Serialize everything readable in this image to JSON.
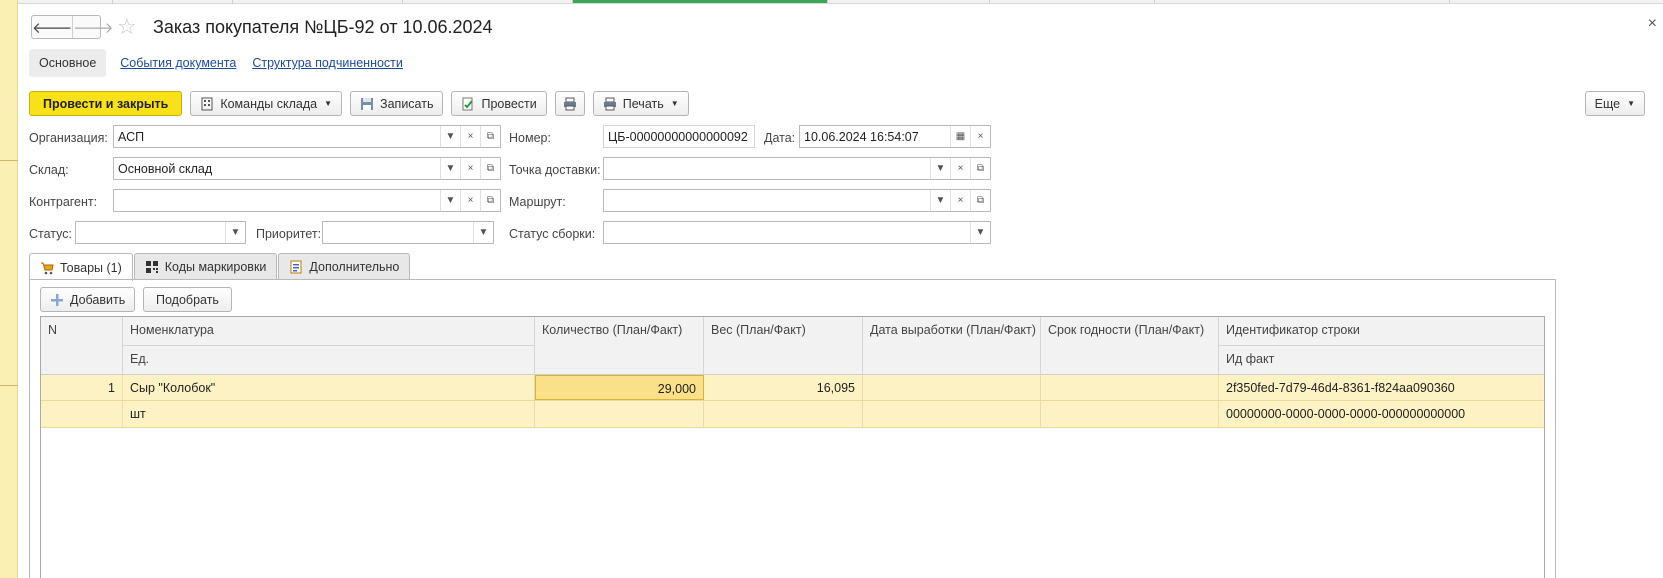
{
  "window": {
    "title": "Заказ покупателя №ЦБ-92 от 10.06.2024",
    "back_icon": "🡐",
    "forward_icon": "🡒",
    "close_icon": "×"
  },
  "sections": {
    "main": "Основное",
    "events": "События документа",
    "structure": "Структура подчиненности"
  },
  "toolbar": {
    "post_close": "Провести и закрыть",
    "warehouse_commands": "Команды склада",
    "save": "Записать",
    "post": "Провести",
    "print": "Печать",
    "more": "Еще"
  },
  "form": {
    "org_label": "Организация:",
    "org_value": "АСП",
    "number_label": "Номер:",
    "number_value": "ЦБ-00000000000000092",
    "date_label": "Дата:",
    "date_value": "10.06.2024 16:54:07",
    "warehouse_label": "Склад:",
    "warehouse_value": "Основной склад",
    "delivery_label": "Точка доставки:",
    "delivery_value": "",
    "counterparty_label": "Контрагент:",
    "counterparty_value": "",
    "route_label": "Маршрут:",
    "route_value": "",
    "status_label": "Статус:",
    "status_value": "",
    "priority_label": "Приоритет:",
    "priority_value": "",
    "assembly_label": "Статус сборки:",
    "assembly_value": ""
  },
  "tabs": {
    "goods": "Товары (1)",
    "codes": "Коды маркировки",
    "extra": "Дополнительно"
  },
  "table_toolbar": {
    "add": "Добавить",
    "pick": "Подобрать"
  },
  "table": {
    "headers": {
      "n": "N",
      "nomenclature": "Номенклатура",
      "unit": "Ед.",
      "qty": "Количество (План/Факт)",
      "weight": "Вес (План/Факт)",
      "prod_date": "Дата выработки (План/Факт)",
      "expiry": "Срок годности (План/Факт)",
      "row_id": "Идентификатор строки",
      "fact_id": "Ид факт"
    },
    "rows": [
      {
        "n": "1",
        "nomenclature": "Сыр \"Колобок\"",
        "unit": "шт",
        "qty": "29,000",
        "weight": "16,095",
        "prod_date": "",
        "expiry": "",
        "row_id": "2f350fed-7d79-46d4-8361-f824aa090360",
        "fact_id": "00000000-0000-0000-0000-000000000000"
      }
    ]
  },
  "colors": {
    "primary_button": "#f9e11a",
    "selected_row": "#fdf2c3",
    "link": "#1a4b9c"
  }
}
